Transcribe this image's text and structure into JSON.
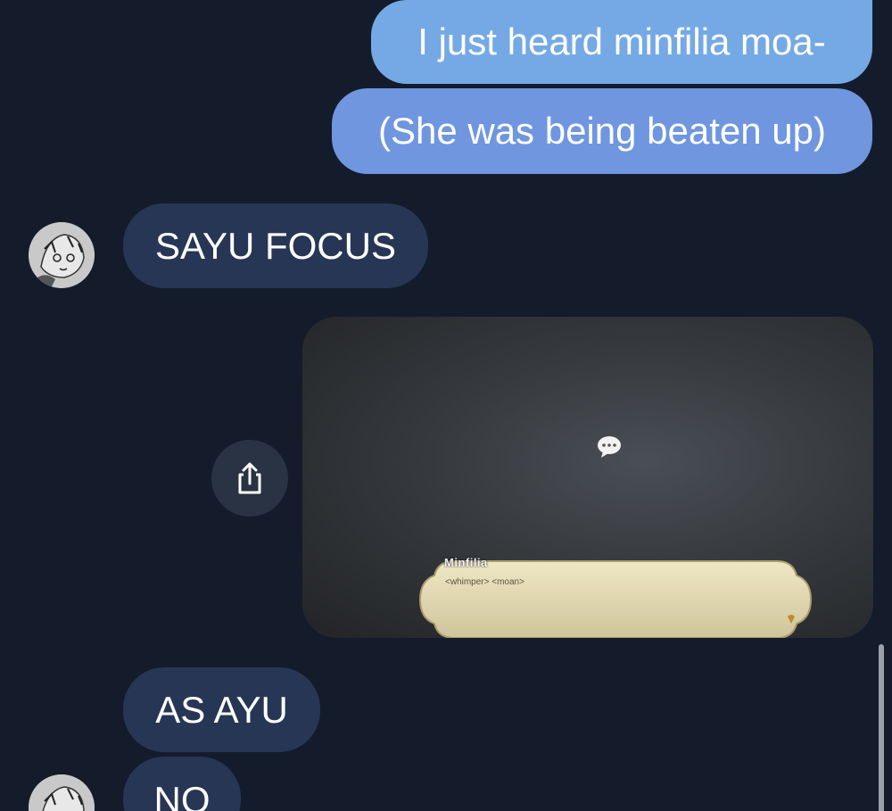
{
  "messages": {
    "outgoing": [
      {
        "text": "I just heard minfilia moa-"
      },
      {
        "text": "(She was being beaten up)"
      }
    ],
    "incoming": [
      {
        "text": "SAYU FOCUS"
      },
      {
        "text": "AS AYU"
      },
      {
        "text": "NO"
      }
    ]
  },
  "image_message": {
    "speaker_name": "Minfilia",
    "dialog_text": "<whimper> <moan>"
  },
  "icons": {
    "share": "share-icon",
    "avatar": "avatar-image",
    "speech": "speech-bubble-icon"
  },
  "colors": {
    "background": "#141c2b",
    "outgoing_bubble": "#74a9e5",
    "incoming_bubble": "#263654",
    "text": "#ffffff"
  }
}
